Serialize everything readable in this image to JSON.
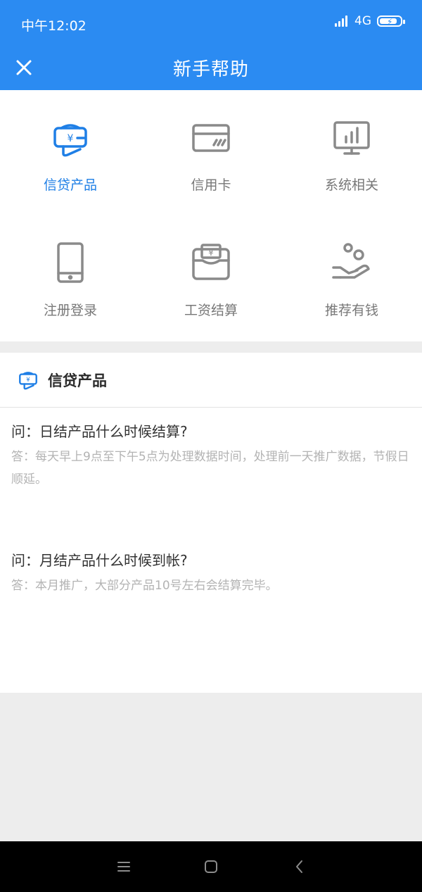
{
  "status_bar": {
    "time": "中午12:02",
    "network": "4G"
  },
  "nav": {
    "title": "新手帮助"
  },
  "categories": [
    {
      "label": "信贷产品",
      "icon": "loan-icon",
      "active": true
    },
    {
      "label": "信用卡",
      "icon": "credit-card-icon",
      "active": false
    },
    {
      "label": "系统相关",
      "icon": "monitor-chart-icon",
      "active": false
    },
    {
      "label": "注册登录",
      "icon": "phone-icon",
      "active": false
    },
    {
      "label": "工资结算",
      "icon": "wallet-icon",
      "active": false
    },
    {
      "label": "推荐有钱",
      "icon": "hand-coins-icon",
      "active": false
    }
  ],
  "section": {
    "title": "信贷产品",
    "faqs": [
      {
        "question": "问：日结产品什么时候结算?",
        "answer": "答：每天早上9点至下午5点为处理数据时间，处理前一天推广数据，节假日顺延。"
      },
      {
        "question": "问：月结产品什么时候到帐?",
        "answer": "答：本月推广，大部分产品10号左右会结算完毕。"
      }
    ]
  },
  "colors": {
    "primary": "#2b8bf2",
    "active_text": "#1f7fe6",
    "inactive_text": "#777777",
    "answer_text": "#b3b3b3"
  }
}
